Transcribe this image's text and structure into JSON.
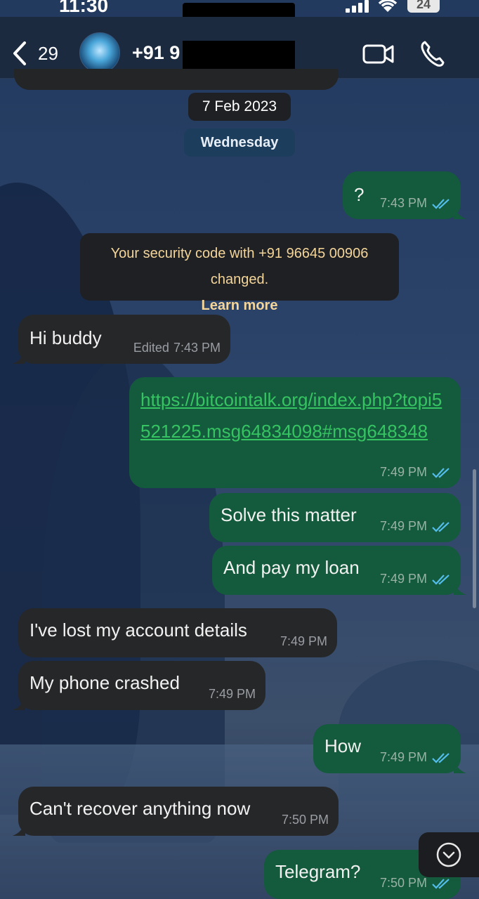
{
  "status_bar": {
    "time": "11:30",
    "battery": "24"
  },
  "header": {
    "back_count": "29",
    "contact_name": "+91 9",
    "redacted": true
  },
  "chat": {
    "date": "7 Feb 2023",
    "day": "Wednesday",
    "security_notice": {
      "text": "Your security code with +91 96645 00906 changed.",
      "link": "Learn more"
    },
    "messages": [
      {
        "dir": "out",
        "text": "?",
        "time": "7:43 PM",
        "read": true
      },
      {
        "dir": "in",
        "text": "Hi buddy",
        "edited": "Edited",
        "time": "7:43 PM"
      },
      {
        "dir": "out",
        "text": "https://bitcointalk.org/index.php?topi5521225.msg64834098#msg648348",
        "time": "7:49 PM",
        "read": true
      },
      {
        "dir": "out",
        "text": "Solve this matter",
        "time": "7:49 PM",
        "read": true
      },
      {
        "dir": "out",
        "text": "And pay my loan",
        "time": "7:49 PM",
        "read": true
      },
      {
        "dir": "in",
        "text": "I've lost my account details",
        "time": "7:49 PM"
      },
      {
        "dir": "in",
        "text": "My phone crashed",
        "time": "7:49 PM"
      },
      {
        "dir": "out",
        "text": "How",
        "time": "7:49 PM",
        "read": true
      },
      {
        "dir": "in",
        "text": "Can't recover anything now",
        "time": "7:50 PM"
      },
      {
        "dir": "out",
        "text": "Telegram?",
        "time": "7:50 PM",
        "read": true
      }
    ]
  },
  "colors": {
    "outgoing_bubble": "#145a3c",
    "incoming_bubble": "#262729",
    "read_tick": "#53bdeb",
    "link": "#36c463",
    "security_text": "#f4d59a"
  },
  "icons": {
    "back": "chevron-left-icon",
    "video": "video-camera-icon",
    "call": "phone-icon",
    "scroll": "chevron-down-icon"
  }
}
